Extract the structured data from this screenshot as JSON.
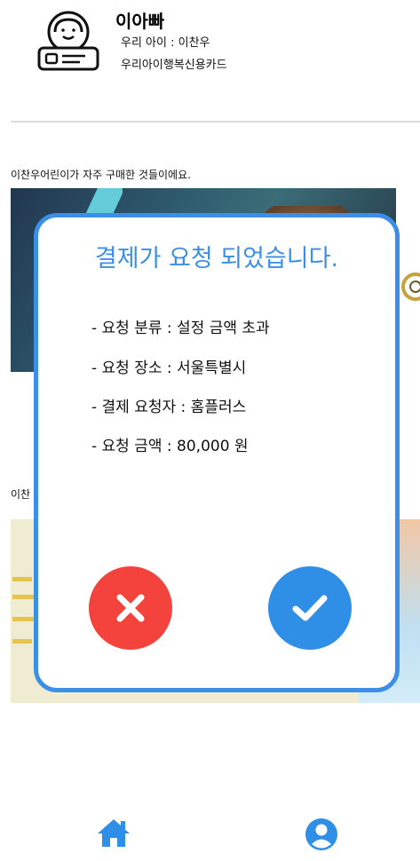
{
  "header": {
    "user_name": "이아빠",
    "child_line": "우리 아이 : 이찬우",
    "card_line": "우리아이행복신용카드"
  },
  "content": {
    "section1_title": "이찬우어린이가 자주 구매한 것들이에요.",
    "section2_title": "이찬"
  },
  "modal": {
    "title": "결제가 요청 되었습니다.",
    "details": [
      "- 요청 분류 : 설정 금액 초과",
      "- 요청 장소 : 서울특별시",
      "- 결제 요청자 : 홈플러스",
      "- 요청 금액 : 80,000 원"
    ]
  },
  "colors": {
    "accent": "#3b8fe6",
    "cancel": "#f4433c",
    "confirm": "#2f8ee5"
  },
  "icons": {
    "profile": "child-card-avatar-icon",
    "home": "home-icon",
    "user": "user-icon",
    "cancel": "x-icon",
    "confirm": "check-icon"
  }
}
